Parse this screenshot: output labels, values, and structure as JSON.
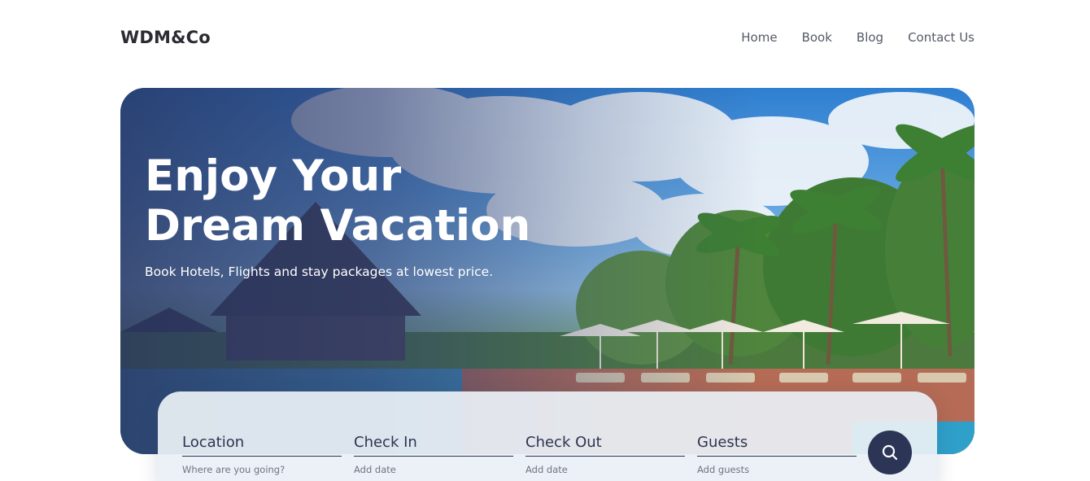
{
  "brand": {
    "logo": "WDM&Co"
  },
  "nav": {
    "items": [
      "Home",
      "Book",
      "Blog",
      "Contact Us"
    ]
  },
  "hero": {
    "title_line1": "Enjoy Your",
    "title_line2": "Dream Vacation",
    "subtitle": "Book Hotels, Flights and stay packages at lowest price."
  },
  "search": {
    "fields": [
      {
        "label": "Location",
        "placeholder": "Where are you going?"
      },
      {
        "label": "Check In",
        "placeholder": "Add date"
      },
      {
        "label": "Check Out",
        "placeholder": "Add date"
      },
      {
        "label": "Guests",
        "placeholder": "Add guests"
      }
    ],
    "button_icon": "search-icon"
  },
  "colors": {
    "accent": "#2c3556",
    "text": "#2b2b33",
    "nav": "#555a66"
  }
}
